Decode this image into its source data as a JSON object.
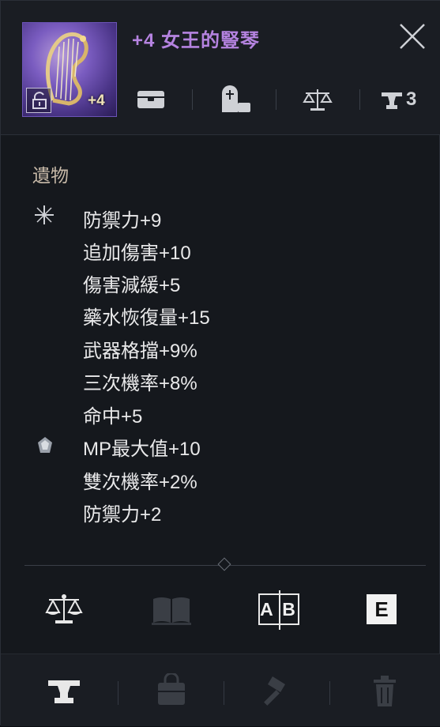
{
  "item": {
    "title": "+4 女王的豎琴",
    "enhance_badge": "+4",
    "rarity_color": "#b583e0"
  },
  "quick": {
    "stack_count": "3",
    "icons": [
      "box-icon",
      "tombstone-icon",
      "scale-icon",
      "anvil-icon"
    ]
  },
  "stats": {
    "section_title": "遺物",
    "lines": [
      "防禦力+9",
      "追加傷害+10",
      "傷害減緩+5",
      "藥水恢復量+15",
      "武器格擋+9%",
      "三次機率+8%",
      "命中+5",
      "MP最大值+10",
      "雙次機率+2%",
      "防禦力+2"
    ]
  },
  "actions": {
    "compare_label": "A B",
    "equip_key": "E"
  },
  "colors": {
    "panel_bg": "#15181d",
    "header_bg": "#1a1d23",
    "title_purple": "#b583e0",
    "section_title": "#c7b9a8"
  }
}
